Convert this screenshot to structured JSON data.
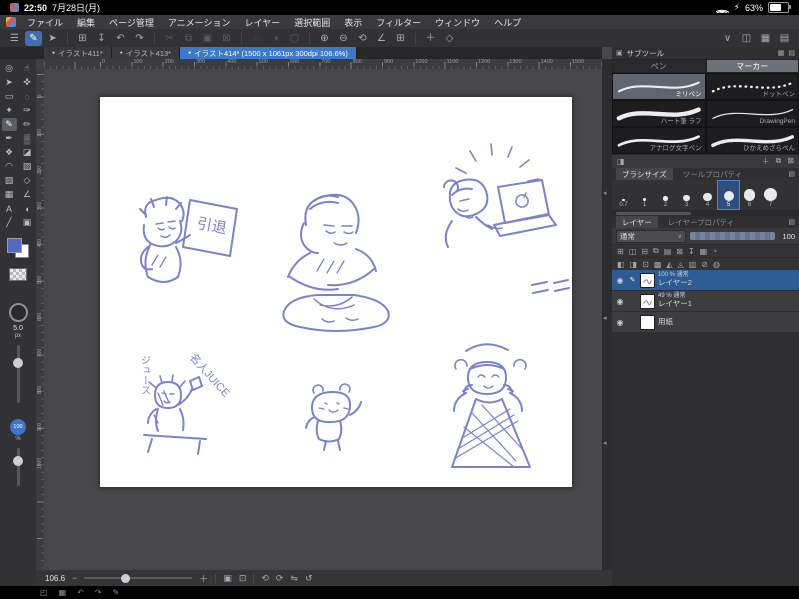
{
  "status_bar": {
    "time": "22:50",
    "date": "7月28日(月)",
    "battery_bolt": "⚡",
    "battery_percent": "63%"
  },
  "menu_bar": {
    "items": [
      "ファイル",
      "編集",
      "ページ管理",
      "アニメーション",
      "レイヤー",
      "選択範囲",
      "表示",
      "フィルター",
      "ウィンドウ",
      "ヘルプ"
    ]
  },
  "command_bar": {
    "icons": [
      {
        "name": "main-menu-icon",
        "glyph": "☰"
      },
      {
        "name": "pen-mode-icon",
        "glyph": "✎",
        "active": true
      },
      {
        "name": "select-mode-icon",
        "glyph": "➤"
      },
      {
        "type": "sep"
      },
      {
        "name": "new-canvas-icon",
        "glyph": "⊞"
      },
      {
        "name": "save-icon",
        "glyph": "↧"
      },
      {
        "name": "undo-icon",
        "glyph": "↶"
      },
      {
        "name": "redo-icon",
        "glyph": "↷"
      },
      {
        "type": "sep"
      },
      {
        "name": "cut-icon",
        "glyph": "✂",
        "dim": true
      },
      {
        "name": "copy-icon",
        "glyph": "⧉",
        "dim": true
      },
      {
        "name": "paste-icon",
        "glyph": "▣",
        "dim": true
      },
      {
        "name": "delete-icon",
        "glyph": "⊠",
        "dim": true
      },
      {
        "type": "sep"
      },
      {
        "name": "deselect-icon",
        "glyph": "◌",
        "dim": true
      },
      {
        "name": "invert-selection-icon",
        "glyph": "◑",
        "dim": true
      },
      {
        "name": "selection-launcher-icon",
        "glyph": "▢",
        "dim": true
      },
      {
        "type": "sep"
      },
      {
        "name": "zoom-in-icon",
        "glyph": "⊕"
      },
      {
        "name": "zoom-out-icon",
        "glyph": "⊖"
      },
      {
        "name": "rotate-canvas-icon",
        "glyph": "⟲"
      },
      {
        "name": "snap-ruler-icon",
        "glyph": "∠"
      },
      {
        "name": "grid-icon",
        "glyph": "⊞"
      },
      {
        "type": "sep"
      },
      {
        "name": "add-icon",
        "glyph": "＋"
      },
      {
        "name": "special-ruler-icon",
        "glyph": "◇"
      }
    ],
    "collapse_glyph": "∨",
    "right_icons": [
      {
        "name": "subtool-palette-toggle-icon",
        "glyph": "◫"
      },
      {
        "name": "brush-size-palette-toggle-icon",
        "glyph": "▦"
      },
      {
        "name": "layer-palette-toggle-icon",
        "glyph": "▤"
      }
    ]
  },
  "tabs": {
    "items": [
      {
        "label": "イラスト411*",
        "modified": true
      },
      {
        "label": "イラスト413*",
        "modified": true
      },
      {
        "label": "イラスト414* (1500 x 1061px 300dpi 106.6%)",
        "modified": true,
        "active": true
      }
    ]
  },
  "rulers": {
    "top_labels": [
      "0",
      "100",
      "200",
      "300",
      "400",
      "500",
      "600",
      "700",
      "800",
      "900",
      "1000",
      "1100",
      "1200",
      "1300",
      "1400",
      "1500"
    ],
    "left_labels": [
      "0",
      "100",
      "200",
      "300",
      "400",
      "500",
      "600",
      "700",
      "800",
      "900",
      "1000"
    ]
  },
  "left_toolbar": {
    "tools": [
      {
        "name": "zoom-tool",
        "glyph": "◎"
      },
      {
        "name": "move-canvas-tool",
        "glyph": "☝"
      },
      {
        "name": "operation-tool",
        "glyph": "➤"
      },
      {
        "name": "layer-move-tool",
        "glyph": "✜"
      },
      {
        "name": "selection-tool",
        "glyph": "▭"
      },
      {
        "name": "lasso-tool",
        "glyph": "◌"
      },
      {
        "name": "auto-select-tool",
        "glyph": "✦"
      },
      {
        "name": "eyedropper-tool",
        "glyph": "✑"
      },
      {
        "name": "pen-tool",
        "glyph": "✎",
        "selected": true
      },
      {
        "name": "pencil-tool",
        "glyph": "✏"
      },
      {
        "name": "brush-tool",
        "glyph": "✒"
      },
      {
        "name": "airbrush-tool",
        "glyph": "▒"
      },
      {
        "name": "decoration-tool",
        "glyph": "❖"
      },
      {
        "name": "eraser-tool",
        "glyph": "◪"
      },
      {
        "name": "blend-tool",
        "glyph": "◠"
      },
      {
        "name": "fill-tool",
        "glyph": "▨"
      },
      {
        "name": "gradient-tool",
        "glyph": "▧"
      },
      {
        "name": "figure-tool",
        "glyph": "◇"
      },
      {
        "name": "frame-border-tool",
        "glyph": "▦"
      },
      {
        "name": "ruler-tool",
        "glyph": "∠"
      },
      {
        "name": "text-tool",
        "glyph": "A"
      },
      {
        "name": "balloon-tool",
        "glyph": "◖"
      },
      {
        "name": "correct-line-tool",
        "glyph": "╱"
      },
      {
        "name": "sub-view-tool",
        "glyph": "▣"
      }
    ],
    "primary_color": "#5468c2",
    "secondary_color": "#ffffff",
    "brush_size": {
      "value": "5.0",
      "unit": "px"
    },
    "opacity": {
      "value": "100",
      "unit": "%"
    }
  },
  "canvas": {
    "sign_text": "引退",
    "vertical_text": "ジュース",
    "diagonal_text": "名人JUICE",
    "ink_color": "#7d83c8"
  },
  "subtool": {
    "title": "サブツール",
    "tabs": [
      {
        "label": "ペン"
      },
      {
        "label": "マーカー",
        "active": true
      }
    ],
    "brushes": [
      {
        "name": "ミリペン",
        "selected": true,
        "style": "solid",
        "width": 2.2
      },
      {
        "name": "ドットペン",
        "style": "dotted",
        "width": 2.4
      },
      {
        "name": "ハート筆 ラフ",
        "style": "solid",
        "width": 4.6
      },
      {
        "name": "DrawingPen",
        "style": "solid",
        "width": 1.3
      },
      {
        "name": "アナログ文字ペン",
        "style": "solid",
        "width": 2.8
      },
      {
        "name": "ひかえめざらぺん",
        "style": "rough",
        "width": 3.6
      }
    ]
  },
  "brush_size_panel": {
    "title": "ブラシサイズ",
    "alt_tab": "ツールプロパティ",
    "sizes": [
      "0.7",
      "1",
      "2",
      "3",
      "4",
      "5",
      "6",
      "7"
    ],
    "selected": "5"
  },
  "layer_panel": {
    "tab": "レイヤー",
    "alt_tab": "レイヤープロパティ",
    "blend_mode": "通常",
    "opacity_value": "100",
    "icon_rows": [
      [
        {
          "name": "new-layer-icon",
          "glyph": "⊞"
        },
        {
          "name": "new-folder-icon",
          "glyph": "◫"
        },
        {
          "name": "transfer-down-icon",
          "glyph": "⊟"
        },
        {
          "name": "duplicate-layer-icon",
          "glyph": "⧉"
        },
        {
          "name": "merge-down-icon",
          "glyph": "▤"
        },
        {
          "name": "delete-layer-icon",
          "glyph": "⊠"
        },
        {
          "name": "import-icon",
          "glyph": "↧"
        },
        {
          "name": "layer-mask-icon",
          "glyph": "▦"
        },
        {
          "name": "onion-skin-icon",
          "glyph": "◔"
        }
      ],
      [
        {
          "name": "clip-to-layer-icon",
          "glyph": "◧"
        },
        {
          "name": "lock-layer-icon",
          "glyph": "◨"
        },
        {
          "name": "lock-transparent-icon",
          "glyph": "⊡"
        },
        {
          "name": "tone-icon",
          "glyph": "▩"
        },
        {
          "name": "layer-color-icon",
          "glyph": "◭"
        },
        {
          "name": "ruler-range-icon",
          "glyph": "◬"
        },
        {
          "name": "reference-layer-icon",
          "glyph": "▥"
        },
        {
          "name": "draft-layer-icon",
          "glyph": "⊘"
        },
        {
          "name": "target-icon",
          "glyph": "◍"
        }
      ]
    ],
    "layers": [
      {
        "info": "100 % 通常",
        "name": "レイヤー2",
        "selected": true,
        "editing": true,
        "thumb": "sketch"
      },
      {
        "info": "49 % 通常",
        "name": "レイヤー1",
        "thumb": "sketch"
      },
      {
        "name": "用紙",
        "thumb": "paper"
      }
    ]
  },
  "bottom_bar": {
    "zoom": "106.6",
    "icons": [
      {
        "name": "zoom-out-button",
        "glyph": "−"
      },
      {
        "type": "slider",
        "name": "zoom-slider"
      },
      {
        "name": "zoom-in-button",
        "glyph": "＋"
      },
      {
        "type": "sep"
      },
      {
        "name": "fit-to-screen-icon",
        "glyph": "▣"
      },
      {
        "name": "actual-pixels-icon",
        "glyph": "⊡"
      },
      {
        "type": "sep"
      },
      {
        "name": "rotate-left-icon",
        "glyph": "⟲"
      },
      {
        "name": "rotate-right-icon",
        "glyph": "⟳"
      },
      {
        "name": "flip-horizontal-icon",
        "glyph": "⇋"
      },
      {
        "name": "reset-rotation-icon",
        "glyph": "↺"
      }
    ]
  },
  "edge_bar": {
    "icons": [
      {
        "name": "edge-palette-icon",
        "glyph": "◰"
      },
      {
        "name": "edge-keyboard-icon",
        "glyph": "▦"
      },
      {
        "name": "edge-undo-icon",
        "glyph": "↶"
      },
      {
        "name": "edge-redo-icon",
        "glyph": "↷"
      },
      {
        "name": "edge-pen-settings-icon",
        "glyph": "✎"
      }
    ]
  },
  "icons": {
    "eye": "◉",
    "pencil": "✎",
    "chevron_down": "∨",
    "collapse": "◂",
    "panel": "▣",
    "grid": "▦",
    "list": "▤",
    "plus": "＋",
    "duplicate": "⧉",
    "trash": "⊠",
    "half": "◨",
    "paper": "▢"
  }
}
